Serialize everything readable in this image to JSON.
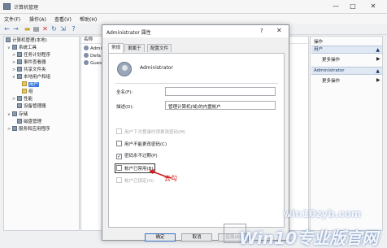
{
  "window": {
    "title": "计算机管理",
    "controls": [
      "—",
      "□",
      "✕"
    ]
  },
  "menu": [
    "文件(F)",
    "操作(A)",
    "查看(V)",
    "帮助(H)"
  ],
  "toolbar": {
    "icons": [
      "back-icon",
      "forward-icon",
      "folder-icon",
      "properties-icon",
      "delete-icon",
      "refresh-icon",
      "export-icon",
      "help-icon"
    ]
  },
  "tree": {
    "items": [
      {
        "label": "计算机管理(本地)",
        "level": 0,
        "toggle": ""
      },
      {
        "label": "系统工具",
        "level": 1,
        "toggle": "∨"
      },
      {
        "label": "任务计划程序",
        "level": 2,
        "toggle": ">"
      },
      {
        "label": "事件查看器",
        "level": 2,
        "toggle": ">"
      },
      {
        "label": "共享文件夹",
        "level": 2,
        "toggle": ">"
      },
      {
        "label": "本地用户和组",
        "level": 2,
        "toggle": "∨"
      },
      {
        "label": "用户",
        "level": 3,
        "toggle": "",
        "selected": true
      },
      {
        "label": "组",
        "level": 3,
        "toggle": ""
      },
      {
        "label": "性能",
        "level": 2,
        "toggle": ">"
      },
      {
        "label": "设备管理器",
        "level": 2,
        "toggle": ""
      },
      {
        "label": "存储",
        "level": 1,
        "toggle": "∨"
      },
      {
        "label": "磁盘管理",
        "level": 2,
        "toggle": ""
      },
      {
        "label": "服务和应用程序",
        "level": 1,
        "toggle": ">"
      }
    ]
  },
  "list": {
    "header": "名称",
    "rows": [
      "Admi",
      "Defa",
      "Gues"
    ]
  },
  "actions": {
    "title": "操作",
    "sections": [
      {
        "label": "用户",
        "item": "更多操作"
      },
      {
        "label": "Administrator",
        "item": "更多操作"
      }
    ]
  },
  "dialog": {
    "title": "Administrator 属性",
    "help": "?",
    "close": "✕",
    "tabs": [
      "常规",
      "隶属于",
      "配置文件"
    ],
    "username": "Administrator",
    "fullname_label": "全名(F):",
    "fullname_value": "",
    "description_label": "描述(D):",
    "description_value": "管理计算机(域)的内置帐户",
    "checkboxes": [
      {
        "label": "用户下次登录时须更改密码(M)",
        "checked": false,
        "disabled": true
      },
      {
        "label": "用户不能更改密码(C)",
        "checked": false,
        "disabled": false
      },
      {
        "label": "密码永不过期(P)",
        "checked": true,
        "disabled": false
      },
      {
        "label": "帐户已禁用(B)",
        "checked": false,
        "disabled": false
      },
      {
        "label": "帐户已锁定(O)",
        "checked": false,
        "disabled": true
      }
    ],
    "annotation": "去勾",
    "buttons": [
      "确定",
      "取消",
      "应用(A)"
    ]
  },
  "watermark": {
    "site": "win10zyb.com",
    "brand": "Win10专业版官网"
  },
  "colors": {
    "selection": "#3b7ee0",
    "annotation_red": "#d11a1a",
    "action_header": "#dfe8f3"
  }
}
